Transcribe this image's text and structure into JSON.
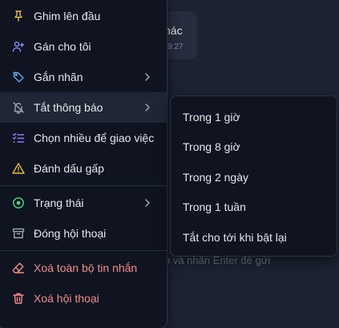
{
  "background": {
    "bubble_text": "hác",
    "bubble_time": "9:27",
    "stray_char": "",
    "input_hint": "n và nhấn Enter để gửi"
  },
  "menu": {
    "items": [
      {
        "label": "Ghim lên đầu",
        "icon": "pin-icon",
        "color": "#e5b84b"
      },
      {
        "label": "Gán cho tôi",
        "icon": "user-plus-icon",
        "color": "#7c93f5"
      },
      {
        "label": "Gắn nhãn",
        "icon": "tag-icon",
        "color": "#5fa8e8",
        "has_submenu": true
      },
      {
        "label": "Tắt thông báo",
        "icon": "bell-off-icon",
        "color": "#9aa3b2",
        "has_submenu": true
      },
      {
        "label": "Chọn nhiều để giao việc",
        "icon": "list-checks-icon",
        "color": "#8b7cf6"
      },
      {
        "label": "Đánh dấu gấp",
        "icon": "warning-icon",
        "color": "#e5b84b"
      },
      {
        "label": "Trạng thái",
        "icon": "circle-dot-icon",
        "color": "#4ade80",
        "has_submenu": true
      },
      {
        "label": "Đóng hội thoại",
        "icon": "archive-icon",
        "color": "#9aa3b2"
      },
      {
        "label": "Xoá toàn bộ tin nhắn",
        "icon": "eraser-icon",
        "color": "#f28b8b"
      },
      {
        "label": "Xoá hội thoại",
        "icon": "trash-icon",
        "color": "#f28b8b"
      }
    ]
  },
  "submenu": {
    "items": [
      "Trong 1 giờ",
      "Trong 8 giờ",
      "Trong 2 ngày",
      "Trong 1 tuần",
      "Tắt cho tới khi bật lại"
    ]
  },
  "colors": {
    "background": "#1c2333",
    "menu_bg": "#0f1420",
    "active_bg": "#1f2636",
    "text": "#e5e7eb",
    "danger": "#f28b8b"
  }
}
